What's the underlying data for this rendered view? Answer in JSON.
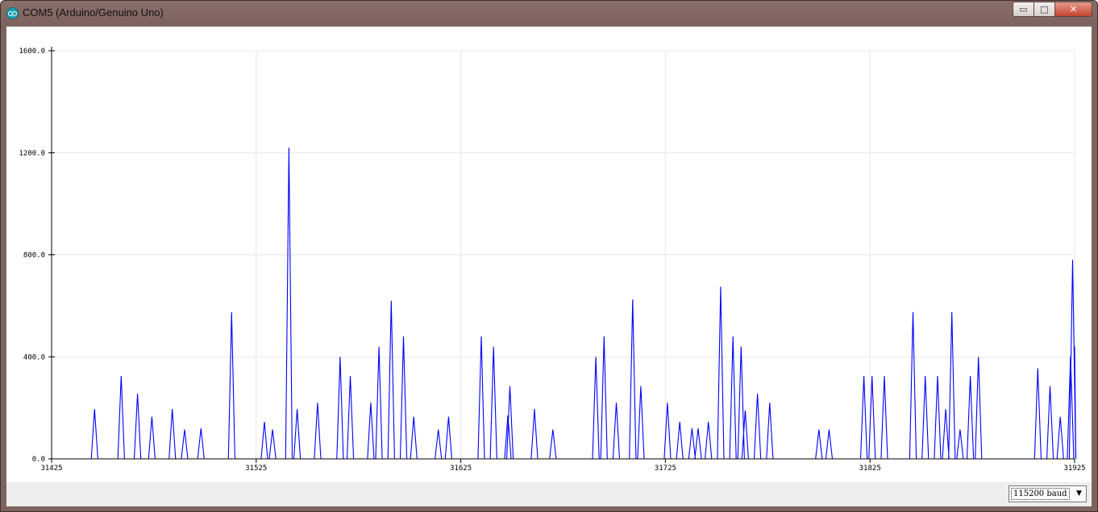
{
  "window": {
    "title": "COM5 (Arduino/Genuino Uno)",
    "buttons": {
      "minimize": "▭",
      "maximize": "□",
      "close": "✕"
    }
  },
  "baud_select": {
    "selected": "115200 baud"
  },
  "colors": {
    "line": "#0000ff",
    "grid": "#e8e8e8",
    "axis": "#000000",
    "bottom_bar": "#eeeeee"
  },
  "chart_data": {
    "type": "line",
    "title": "",
    "xlabel": "",
    "ylabel": "",
    "xlim": [
      31425,
      31925
    ],
    "ylim": [
      0,
      1600
    ],
    "xticks": [
      "31425",
      "31525",
      "31625",
      "31725",
      "31825",
      "31925"
    ],
    "yticks": [
      "0.0",
      "400.0",
      "800.0",
      "1200.0",
      "1600.0"
    ],
    "grid": true,
    "legend": "none",
    "series": [
      {
        "peaks": [
          [
            31446,
            195
          ],
          [
            31459,
            325
          ],
          [
            31467,
            255
          ],
          [
            31474,
            165
          ],
          [
            31484,
            195
          ],
          [
            31490,
            115
          ],
          [
            31498,
            120
          ],
          [
            31513,
            575
          ],
          [
            31529,
            145
          ],
          [
            31533,
            115
          ],
          [
            31541,
            1220
          ],
          [
            31545,
            195
          ],
          [
            31555,
            220
          ],
          [
            31566,
            400
          ],
          [
            31571,
            325
          ],
          [
            31581,
            220
          ],
          [
            31585,
            440
          ],
          [
            31591,
            620
          ],
          [
            31597,
            480
          ],
          [
            31602,
            165
          ],
          [
            31614,
            115
          ],
          [
            31619,
            165
          ],
          [
            31635,
            480
          ],
          [
            31641,
            440
          ],
          [
            31648,
            170
          ],
          [
            31649,
            285
          ],
          [
            31661,
            195
          ],
          [
            31670,
            115
          ],
          [
            31691,
            400
          ],
          [
            31695,
            480
          ],
          [
            31701,
            220
          ],
          [
            31709,
            625
          ],
          [
            31713,
            285
          ],
          [
            31726,
            220
          ],
          [
            31732,
            145
          ],
          [
            31738,
            120
          ],
          [
            31741,
            120
          ],
          [
            31746,
            145
          ],
          [
            31752,
            675
          ],
          [
            31758,
            480
          ],
          [
            31762,
            440
          ],
          [
            31764,
            190
          ],
          [
            31770,
            255
          ],
          [
            31776,
            220
          ],
          [
            31800,
            115
          ],
          [
            31805,
            115
          ],
          [
            31822,
            325
          ],
          [
            31826,
            325
          ],
          [
            31832,
            325
          ],
          [
            31846,
            575
          ],
          [
            31852,
            325
          ],
          [
            31858,
            325
          ],
          [
            31862,
            195
          ],
          [
            31865,
            575
          ],
          [
            31869,
            115
          ],
          [
            31874,
            325
          ],
          [
            31878,
            400
          ],
          [
            31907,
            355
          ],
          [
            31913,
            285
          ],
          [
            31918,
            165
          ],
          [
            31923,
            400
          ],
          [
            31924,
            780
          ]
        ],
        "end_value": 440
      }
    ]
  }
}
